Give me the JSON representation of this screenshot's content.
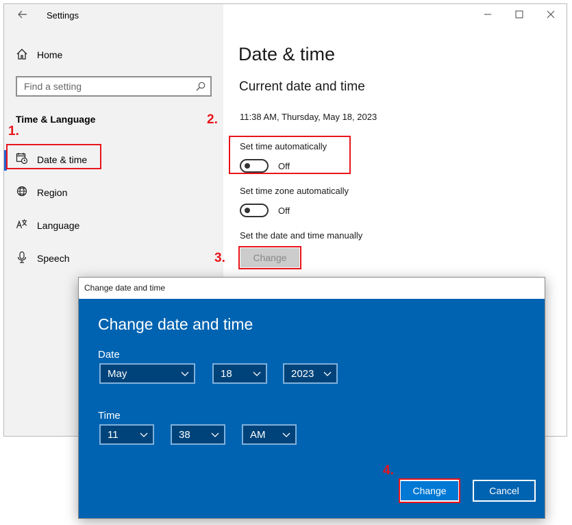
{
  "window": {
    "title": "Settings",
    "controls": [
      "minimize",
      "maximize",
      "close"
    ]
  },
  "sidebar": {
    "home_label": "Home",
    "search_placeholder": "Find a setting",
    "section_title": "Time & Language",
    "items": [
      {
        "label": "Date & time",
        "icon": "calendar-clock-icon",
        "active": true
      },
      {
        "label": "Region",
        "icon": "globe-icon"
      },
      {
        "label": "Language",
        "icon": "language-icon"
      },
      {
        "label": "Speech",
        "icon": "microphone-icon"
      }
    ]
  },
  "main": {
    "page_title": "Date & time",
    "section_title": "Current date and time",
    "current_datetime": "11:38 AM, Thursday, May 18, 2023",
    "set_time_auto": {
      "label": "Set time automatically",
      "state": "Off"
    },
    "set_zone_auto": {
      "label": "Set time zone automatically",
      "state": "Off"
    },
    "manual": {
      "label": "Set the date and time manually",
      "button": "Change"
    }
  },
  "dialog": {
    "title": "Change date and time",
    "heading": "Change date and time",
    "date_label": "Date",
    "time_label": "Time",
    "month": "May",
    "day": "18",
    "year": "2023",
    "hour": "11",
    "minute": "38",
    "ampm": "AM",
    "change_button": "Change",
    "cancel_button": "Cancel"
  },
  "annotations": {
    "step1": "1.",
    "step2": "2.",
    "step3": "3.",
    "step4": "4."
  },
  "colors": {
    "accent": "#2a63d0",
    "annotation_red": "#e8141b",
    "dialog_blue": "#0063b1",
    "dropdown_bg": "#00437a",
    "sidebar_bg": "#f2f2f2"
  }
}
